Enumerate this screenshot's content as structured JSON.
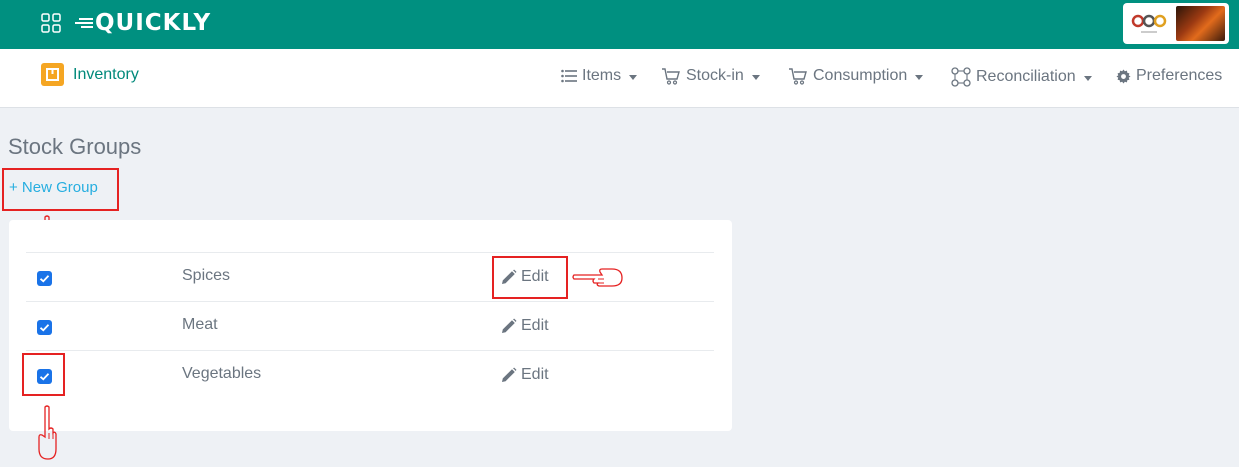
{
  "topbar": {
    "app_name": "QUICKLY",
    "brand_logo_text": "Sowrh Dindia",
    "color": "#009080"
  },
  "navbar": {
    "module_label": "Inventory",
    "items": [
      {
        "label": "Items",
        "icon": "list-icon"
      },
      {
        "label": "Stock-in",
        "icon": "cart-icon"
      },
      {
        "label": "Consumption",
        "icon": "cart-icon"
      },
      {
        "label": "Reconciliation",
        "icon": "nodes-icon"
      },
      {
        "label": "Preferences",
        "icon": "gear-icon"
      }
    ]
  },
  "main": {
    "title": "Stock Groups",
    "new_group_label": "+ New Group",
    "edit_label": "Edit",
    "groups": [
      {
        "name": "Spices",
        "checked": true
      },
      {
        "name": "Meat",
        "checked": true
      },
      {
        "name": "Vegetables",
        "checked": true
      }
    ]
  },
  "colors": {
    "accent": "#009080",
    "link": "#26aee0",
    "checkbox": "#1a73e8",
    "highlight": "#e52222"
  }
}
